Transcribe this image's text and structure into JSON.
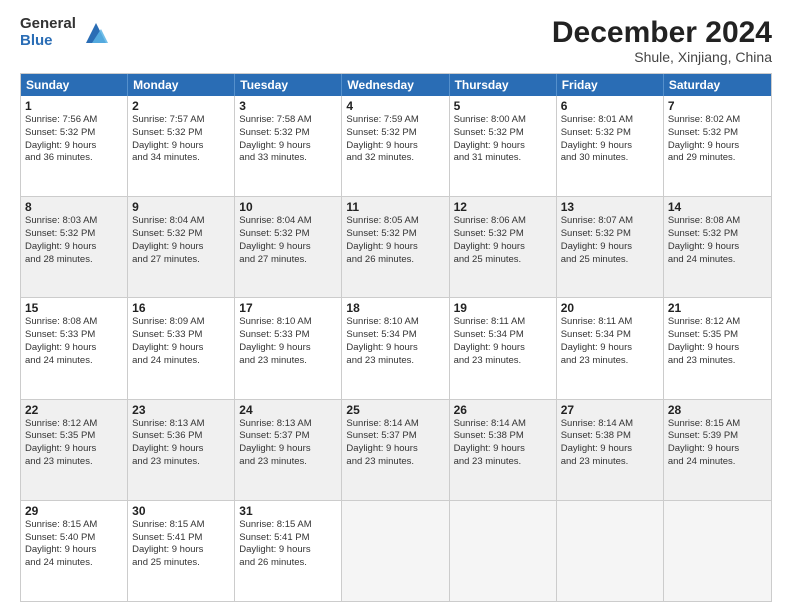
{
  "logo": {
    "general": "General",
    "blue": "Blue"
  },
  "title": "December 2024",
  "location": "Shule, Xinjiang, China",
  "weekdays": [
    "Sunday",
    "Monday",
    "Tuesday",
    "Wednesday",
    "Thursday",
    "Friday",
    "Saturday"
  ],
  "weeks": [
    [
      {
        "day": "1",
        "lines": [
          "Sunrise: 7:56 AM",
          "Sunset: 5:32 PM",
          "Daylight: 9 hours",
          "and 36 minutes."
        ]
      },
      {
        "day": "2",
        "lines": [
          "Sunrise: 7:57 AM",
          "Sunset: 5:32 PM",
          "Daylight: 9 hours",
          "and 34 minutes."
        ]
      },
      {
        "day": "3",
        "lines": [
          "Sunrise: 7:58 AM",
          "Sunset: 5:32 PM",
          "Daylight: 9 hours",
          "and 33 minutes."
        ]
      },
      {
        "day": "4",
        "lines": [
          "Sunrise: 7:59 AM",
          "Sunset: 5:32 PM",
          "Daylight: 9 hours",
          "and 32 minutes."
        ]
      },
      {
        "day": "5",
        "lines": [
          "Sunrise: 8:00 AM",
          "Sunset: 5:32 PM",
          "Daylight: 9 hours",
          "and 31 minutes."
        ]
      },
      {
        "day": "6",
        "lines": [
          "Sunrise: 8:01 AM",
          "Sunset: 5:32 PM",
          "Daylight: 9 hours",
          "and 30 minutes."
        ]
      },
      {
        "day": "7",
        "lines": [
          "Sunrise: 8:02 AM",
          "Sunset: 5:32 PM",
          "Daylight: 9 hours",
          "and 29 minutes."
        ]
      }
    ],
    [
      {
        "day": "8",
        "lines": [
          "Sunrise: 8:03 AM",
          "Sunset: 5:32 PM",
          "Daylight: 9 hours",
          "and 28 minutes."
        ]
      },
      {
        "day": "9",
        "lines": [
          "Sunrise: 8:04 AM",
          "Sunset: 5:32 PM",
          "Daylight: 9 hours",
          "and 27 minutes."
        ]
      },
      {
        "day": "10",
        "lines": [
          "Sunrise: 8:04 AM",
          "Sunset: 5:32 PM",
          "Daylight: 9 hours",
          "and 27 minutes."
        ]
      },
      {
        "day": "11",
        "lines": [
          "Sunrise: 8:05 AM",
          "Sunset: 5:32 PM",
          "Daylight: 9 hours",
          "and 26 minutes."
        ]
      },
      {
        "day": "12",
        "lines": [
          "Sunrise: 8:06 AM",
          "Sunset: 5:32 PM",
          "Daylight: 9 hours",
          "and 25 minutes."
        ]
      },
      {
        "day": "13",
        "lines": [
          "Sunrise: 8:07 AM",
          "Sunset: 5:32 PM",
          "Daylight: 9 hours",
          "and 25 minutes."
        ]
      },
      {
        "day": "14",
        "lines": [
          "Sunrise: 8:08 AM",
          "Sunset: 5:32 PM",
          "Daylight: 9 hours",
          "and 24 minutes."
        ]
      }
    ],
    [
      {
        "day": "15",
        "lines": [
          "Sunrise: 8:08 AM",
          "Sunset: 5:33 PM",
          "Daylight: 9 hours",
          "and 24 minutes."
        ]
      },
      {
        "day": "16",
        "lines": [
          "Sunrise: 8:09 AM",
          "Sunset: 5:33 PM",
          "Daylight: 9 hours",
          "and 24 minutes."
        ]
      },
      {
        "day": "17",
        "lines": [
          "Sunrise: 8:10 AM",
          "Sunset: 5:33 PM",
          "Daylight: 9 hours",
          "and 23 minutes."
        ]
      },
      {
        "day": "18",
        "lines": [
          "Sunrise: 8:10 AM",
          "Sunset: 5:34 PM",
          "Daylight: 9 hours",
          "and 23 minutes."
        ]
      },
      {
        "day": "19",
        "lines": [
          "Sunrise: 8:11 AM",
          "Sunset: 5:34 PM",
          "Daylight: 9 hours",
          "and 23 minutes."
        ]
      },
      {
        "day": "20",
        "lines": [
          "Sunrise: 8:11 AM",
          "Sunset: 5:34 PM",
          "Daylight: 9 hours",
          "and 23 minutes."
        ]
      },
      {
        "day": "21",
        "lines": [
          "Sunrise: 8:12 AM",
          "Sunset: 5:35 PM",
          "Daylight: 9 hours",
          "and 23 minutes."
        ]
      }
    ],
    [
      {
        "day": "22",
        "lines": [
          "Sunrise: 8:12 AM",
          "Sunset: 5:35 PM",
          "Daylight: 9 hours",
          "and 23 minutes."
        ]
      },
      {
        "day": "23",
        "lines": [
          "Sunrise: 8:13 AM",
          "Sunset: 5:36 PM",
          "Daylight: 9 hours",
          "and 23 minutes."
        ]
      },
      {
        "day": "24",
        "lines": [
          "Sunrise: 8:13 AM",
          "Sunset: 5:37 PM",
          "Daylight: 9 hours",
          "and 23 minutes."
        ]
      },
      {
        "day": "25",
        "lines": [
          "Sunrise: 8:14 AM",
          "Sunset: 5:37 PM",
          "Daylight: 9 hours",
          "and 23 minutes."
        ]
      },
      {
        "day": "26",
        "lines": [
          "Sunrise: 8:14 AM",
          "Sunset: 5:38 PM",
          "Daylight: 9 hours",
          "and 23 minutes."
        ]
      },
      {
        "day": "27",
        "lines": [
          "Sunrise: 8:14 AM",
          "Sunset: 5:38 PM",
          "Daylight: 9 hours",
          "and 23 minutes."
        ]
      },
      {
        "day": "28",
        "lines": [
          "Sunrise: 8:15 AM",
          "Sunset: 5:39 PM",
          "Daylight: 9 hours",
          "and 24 minutes."
        ]
      }
    ],
    [
      {
        "day": "29",
        "lines": [
          "Sunrise: 8:15 AM",
          "Sunset: 5:40 PM",
          "Daylight: 9 hours",
          "and 24 minutes."
        ]
      },
      {
        "day": "30",
        "lines": [
          "Sunrise: 8:15 AM",
          "Sunset: 5:41 PM",
          "Daylight: 9 hours",
          "and 25 minutes."
        ]
      },
      {
        "day": "31",
        "lines": [
          "Sunrise: 8:15 AM",
          "Sunset: 5:41 PM",
          "Daylight: 9 hours",
          "and 26 minutes."
        ]
      },
      {
        "day": "",
        "lines": []
      },
      {
        "day": "",
        "lines": []
      },
      {
        "day": "",
        "lines": []
      },
      {
        "day": "",
        "lines": []
      }
    ]
  ]
}
